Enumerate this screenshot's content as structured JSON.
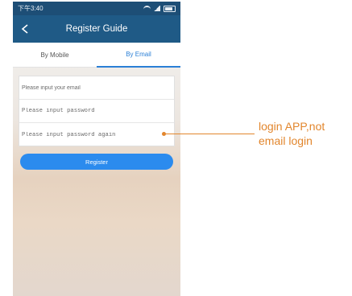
{
  "status_bar": {
    "time": "下午3:40"
  },
  "header": {
    "title": "Register Guide"
  },
  "tabs": [
    {
      "label": "By Mobile"
    },
    {
      "label": "By Email"
    }
  ],
  "form": {
    "email_placeholder": "Please input your email",
    "password_placeholder": "Please input password",
    "password_again_placeholder": "Please input password again"
  },
  "register_button": {
    "label": "Register"
  },
  "annotation": {
    "text": "login APP,not email login"
  },
  "colors": {
    "header_bg": "#1f5a86",
    "accent": "#2b8bee",
    "annotation": "#e2862d"
  }
}
